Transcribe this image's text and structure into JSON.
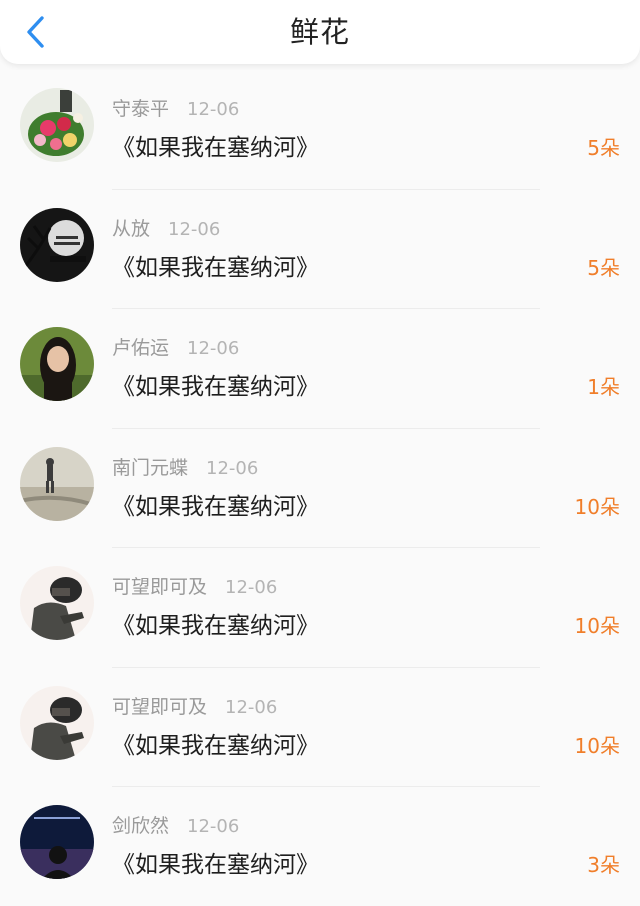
{
  "header": {
    "title": "鲜花",
    "back_icon": "chevron-left-icon",
    "accent": "#2e8ef0"
  },
  "gifts": [
    {
      "user": "守泰平",
      "date": "12-06",
      "book": "《如果我在塞纳河》",
      "count": "5朵",
      "avatar_icon": "flower-bouquet-avatar"
    },
    {
      "user": "从放",
      "date": "12-06",
      "book": "《如果我在塞纳河》",
      "count": "5朵",
      "avatar_icon": "happy-halloween-avatar"
    },
    {
      "user": "卢佑运",
      "date": "12-06",
      "book": "《如果我在塞纳河》",
      "count": "1朵",
      "avatar_icon": "girl-portrait-avatar"
    },
    {
      "user": "南门元蝶",
      "date": "12-06",
      "book": "《如果我在塞纳河》",
      "count": "10朵",
      "avatar_icon": "beach-figure-avatar"
    },
    {
      "user": "可望即可及",
      "date": "12-06",
      "book": "《如果我在塞纳河》",
      "count": "10朵",
      "avatar_icon": "helmet-rider-avatar"
    },
    {
      "user": "可望即可及",
      "date": "12-06",
      "book": "《如果我在塞纳河》",
      "count": "10朵",
      "avatar_icon": "helmet-rider-avatar"
    },
    {
      "user": "剑欣然",
      "date": "12-06",
      "book": "《如果我在塞纳河》",
      "count": "3朵",
      "avatar_icon": "night-sky-avatar"
    }
  ],
  "colors": {
    "count": "#f07e2a",
    "username": "#9a9a9a",
    "book": "#1e1e1e"
  }
}
